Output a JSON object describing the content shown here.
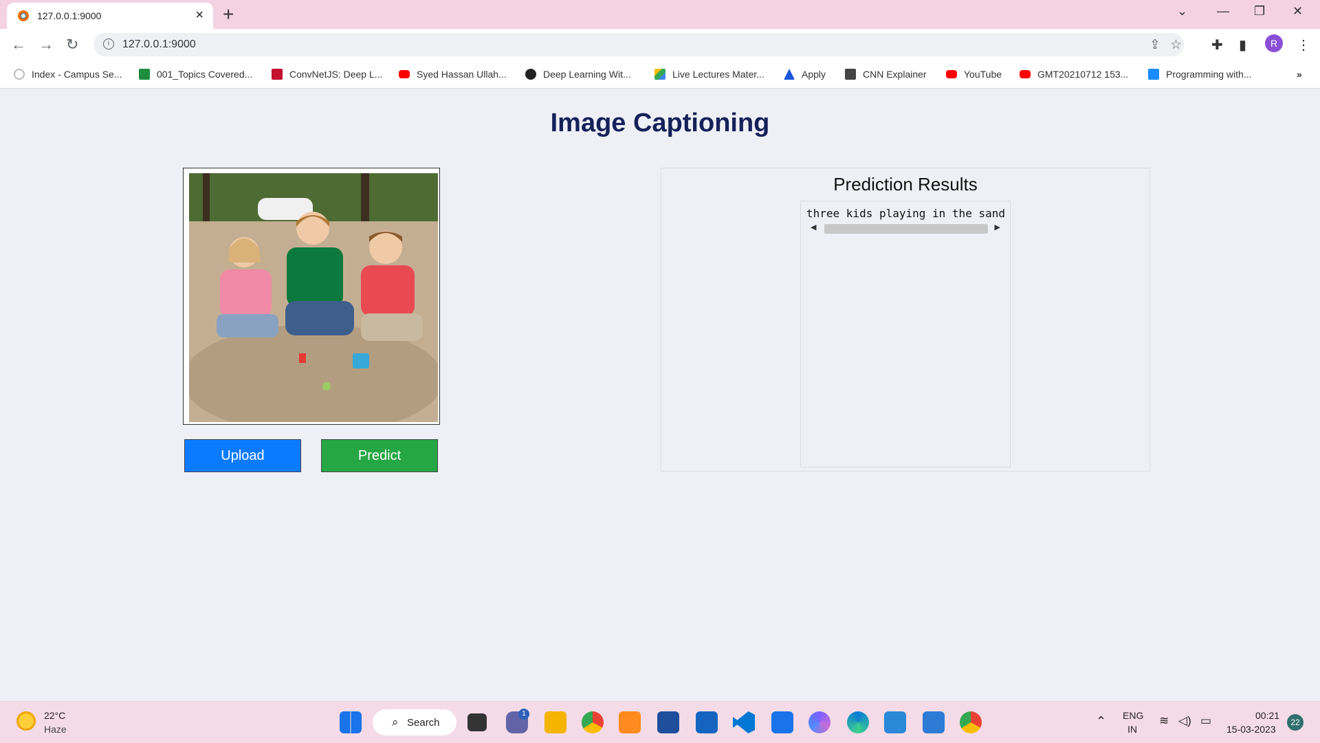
{
  "browser": {
    "tab_title": "127.0.0.1:9000",
    "url": "127.0.0.1:9000",
    "profile_initial": "R"
  },
  "bookmarks": [
    {
      "label": "Index - Campus Se...",
      "icon": "campus-icon",
      "color": "#bbbbbb"
    },
    {
      "label": "001_Topics Covered...",
      "icon": "sheets-icon",
      "color": "#1e8e3e"
    },
    {
      "label": "ConvNetJS: Deep L...",
      "icon": "convnet-icon",
      "color": "#c41230"
    },
    {
      "label": "Syed Hassan Ullah...",
      "icon": "youtube-icon",
      "color": "#ff0000"
    },
    {
      "label": "Deep Learning Wit...",
      "icon": "globe-icon",
      "color": "#222222"
    },
    {
      "label": "Live Lectures Mater...",
      "icon": "drive-icon",
      "color": "#fbbc04"
    },
    {
      "label": "Apply",
      "icon": "apply-icon",
      "color": "#1a56db"
    },
    {
      "label": "CNN Explainer",
      "icon": "cnn-explainer-icon",
      "color": "#444444"
    },
    {
      "label": "YouTube",
      "icon": "youtube-icon",
      "color": "#ff0000"
    },
    {
      "label": "GMT20210712 153...",
      "icon": "youtube-icon",
      "color": "#ff0000"
    },
    {
      "label": "Programming with...",
      "icon": "is-icon",
      "color": "#1a8cff"
    }
  ],
  "page": {
    "title": "Image Captioning",
    "upload_label": "Upload",
    "predict_label": "Predict",
    "results_heading": "Prediction Results",
    "result_text": "three kids playing in the sand"
  },
  "taskbar": {
    "temperature": "22°C",
    "condition": "Haze",
    "search_label": "Search",
    "chat_badge": "1",
    "language": "ENG",
    "region": "IN",
    "time": "00:21",
    "date": "15-03-2023",
    "notification_count": "22"
  }
}
